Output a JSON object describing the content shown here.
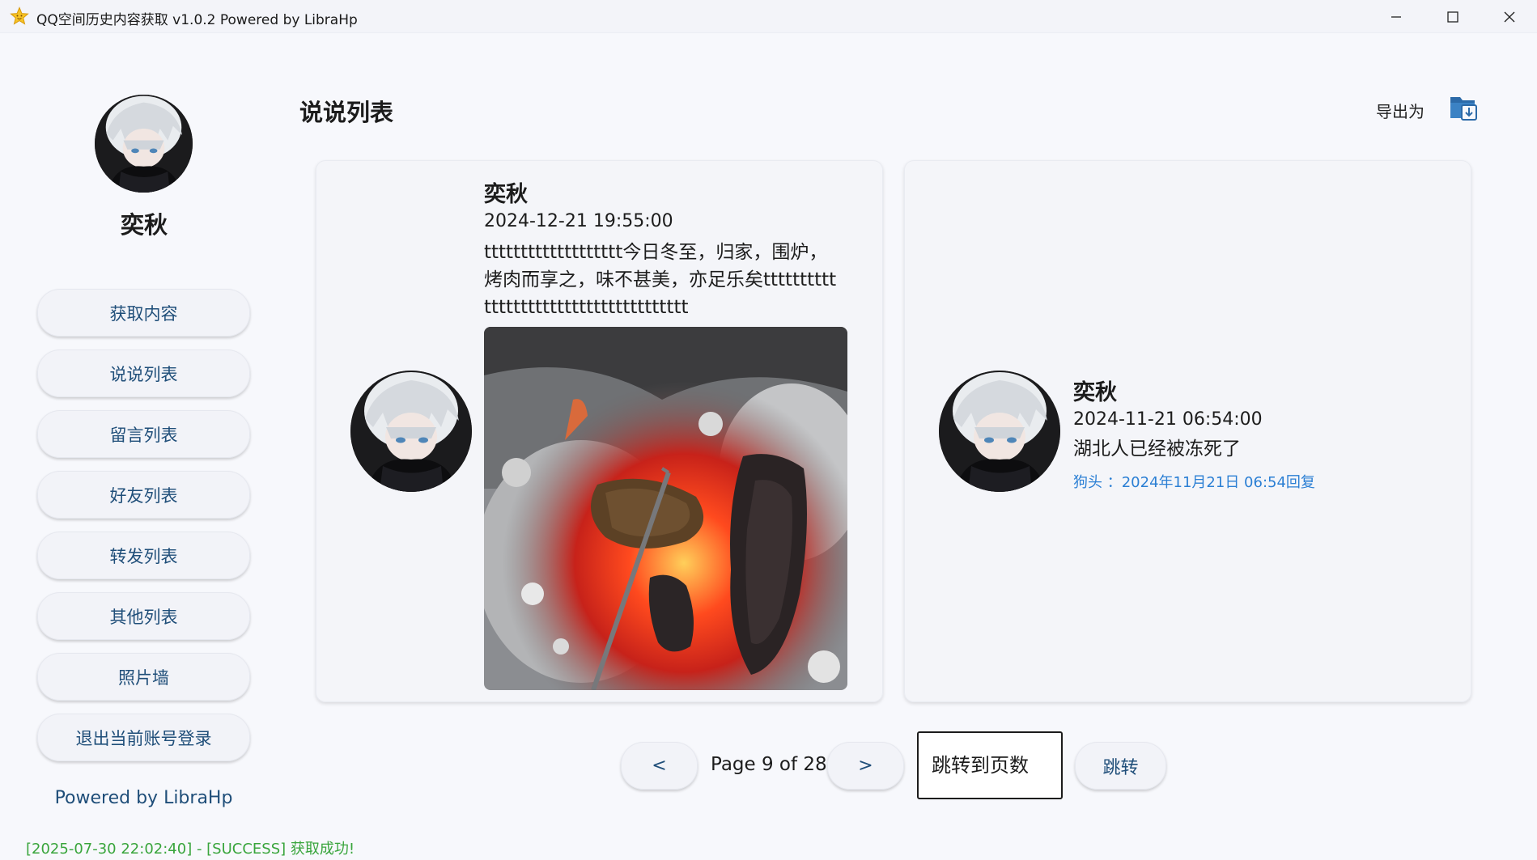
{
  "window": {
    "title": "QQ空间历史内容获取 v1.0.2 Powered by LibraHp",
    "minimize": "—",
    "maximize": "☐",
    "close": "✕",
    "icon": "star-icon"
  },
  "sidebar": {
    "user_name": "奕秋",
    "avatar": "user-avatar",
    "items": [
      {
        "label": "获取内容"
      },
      {
        "label": "说说列表"
      },
      {
        "label": "留言列表"
      },
      {
        "label": "好友列表"
      },
      {
        "label": "转发列表"
      },
      {
        "label": "其他列表"
      },
      {
        "label": "照片墙"
      },
      {
        "label": "退出当前账号登录"
      }
    ],
    "powered_by": "Powered by LibraHp",
    "log": "[2025-07-30 22:02:40] - [SUCCESS] 获取成功!"
  },
  "header": {
    "title": "说说列表",
    "export_label": "导出为",
    "export_icon": "export-icon"
  },
  "posts": [
    {
      "author": "奕秋",
      "time": "2024-12-21 19:55:00",
      "text": "ttttttttttttttttttt今日冬至，归家，围炉，烤肉而享之，味不甚美，亦足乐矣tttttttttttttttttttttttttttttttttttttt",
      "has_photo": true
    },
    {
      "author": "奕秋",
      "time": "2024-11-21 06:54:00",
      "text": "湖北人已经被冻死了",
      "comment": "狗头 ：2024年11月21日 06:54回复"
    }
  ],
  "pagination": {
    "prev_label": "<",
    "next_label": ">",
    "page_info": "Page 9 of 28",
    "current_page": 9,
    "total_pages": 28,
    "jump_placeholder": "跳转到页数",
    "jump_label": "跳转"
  },
  "colors": {
    "accent": "#1f4e79",
    "success": "#39a53c",
    "link": "#2b7fd4",
    "background": "#f7f8fc"
  }
}
